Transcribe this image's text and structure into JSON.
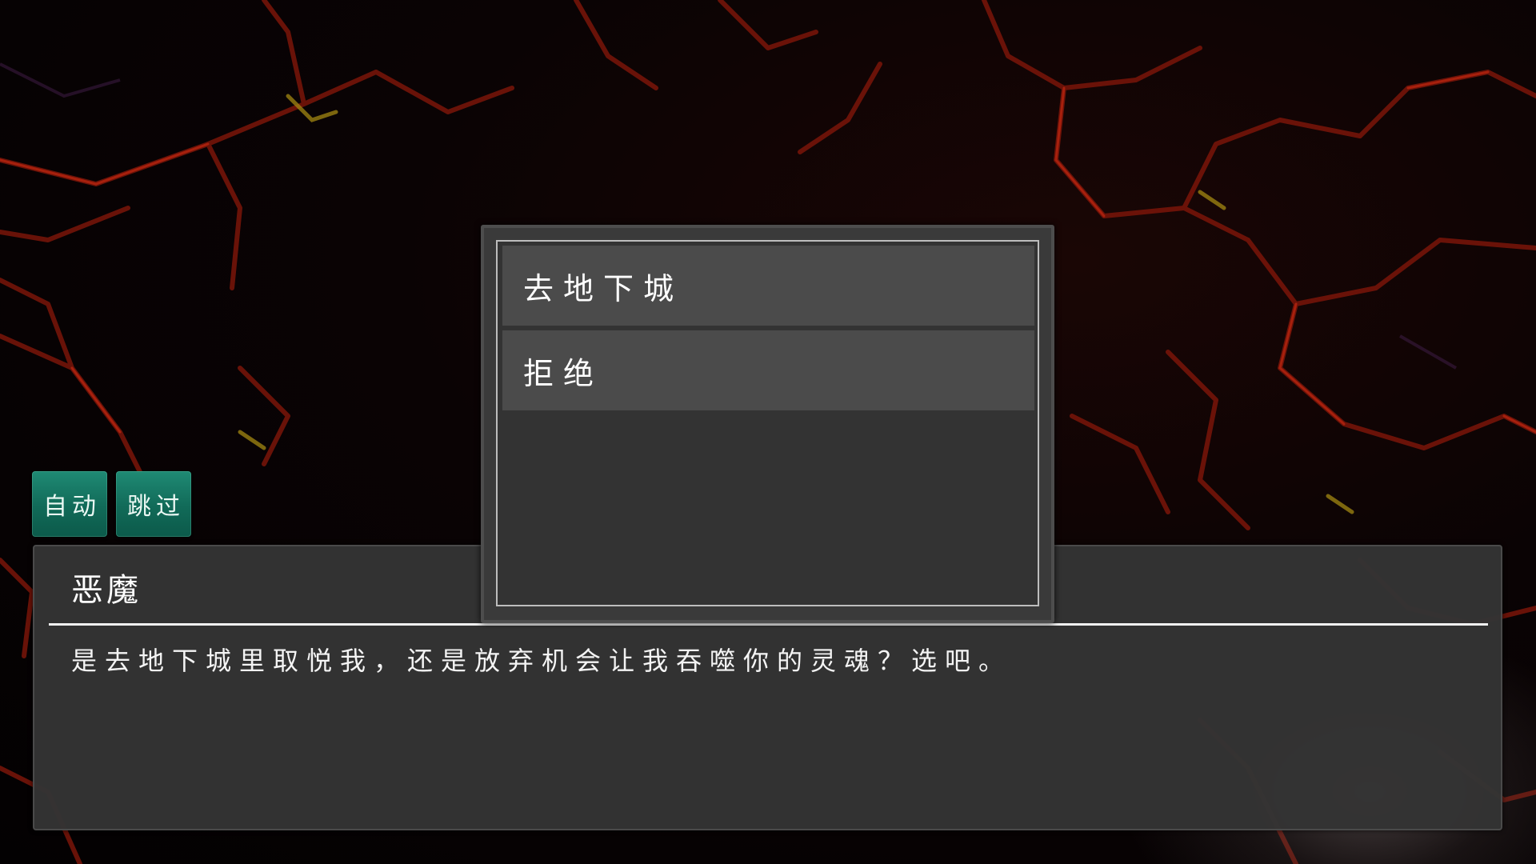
{
  "controls": {
    "auto_label": "自动",
    "skip_label": "跳过"
  },
  "choices": [
    {
      "label": "去地下城"
    },
    {
      "label": "拒绝"
    }
  ],
  "dialogue": {
    "speaker": "恶魔",
    "text": "是去地下城里取悦我，还是放弃机会让我吞噬你的灵魂？选吧。"
  },
  "colors": {
    "button_bg": "#116a58",
    "panel_bg": "#343434",
    "choice_bg": "#4b4b4b",
    "crack_red": "#8a1a10",
    "crack_yellow": "#a88a10"
  }
}
